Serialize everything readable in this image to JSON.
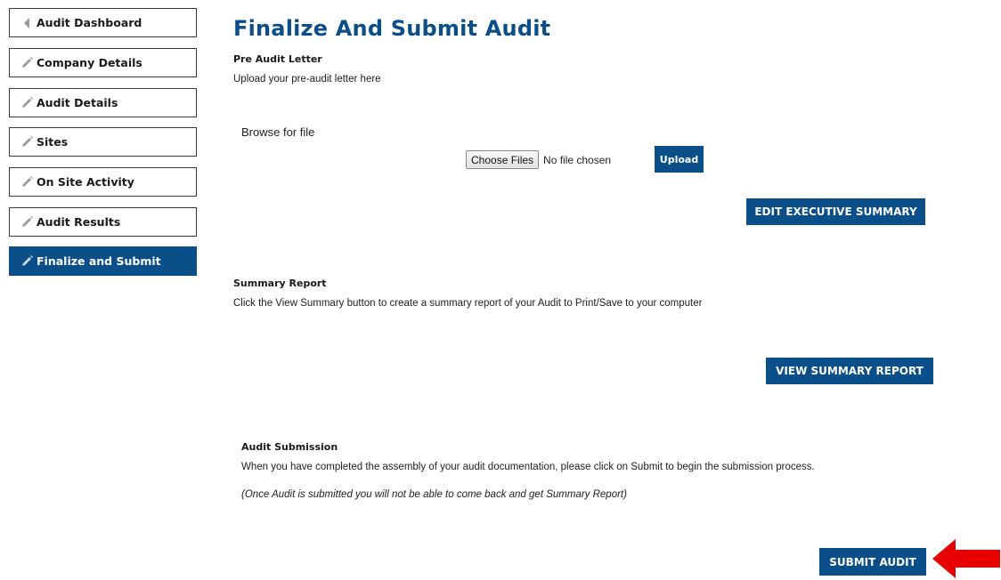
{
  "sidebar": {
    "items": [
      {
        "label": "Audit Dashboard",
        "icon": "chevron-left-icon",
        "active": false
      },
      {
        "label": "Company Details",
        "icon": "pencil-icon",
        "active": false
      },
      {
        "label": "Audit Details",
        "icon": "pencil-icon",
        "active": false
      },
      {
        "label": "Sites",
        "icon": "pencil-icon",
        "active": false
      },
      {
        "label": "On Site Activity",
        "icon": "pencil-icon",
        "active": false
      },
      {
        "label": "Audit Results",
        "icon": "pencil-icon",
        "active": false
      },
      {
        "label": "Finalize and Submit",
        "icon": "pencil-icon",
        "active": true
      }
    ]
  },
  "main": {
    "title": "Finalize And Submit Audit",
    "pre_audit": {
      "heading": "Pre Audit Letter",
      "description": "Upload your pre-audit letter here",
      "browse_label": "Browse for file",
      "choose_files_label": "Choose Files",
      "file_status": "No file chosen",
      "upload_label": "Upload",
      "edit_summary_label": "EDIT EXECUTIVE SUMMARY"
    },
    "summary_report": {
      "heading": "Summary Report",
      "description": "Click the View Summary button to create a summary report of your Audit to Print/Save to your computer",
      "view_label": "VIEW SUMMARY REPORT"
    },
    "submission": {
      "heading": "Audit Submission",
      "description": "When you have completed the assembly of your audit documentation, please click on Submit to begin the submission process.",
      "note": "(Once Audit is submitted you will not be able to come back and get Summary Report)",
      "submit_label": "SUBMIT AUDIT"
    }
  },
  "colors": {
    "brand": "#0b4f8a",
    "arrow": "#e60000"
  }
}
